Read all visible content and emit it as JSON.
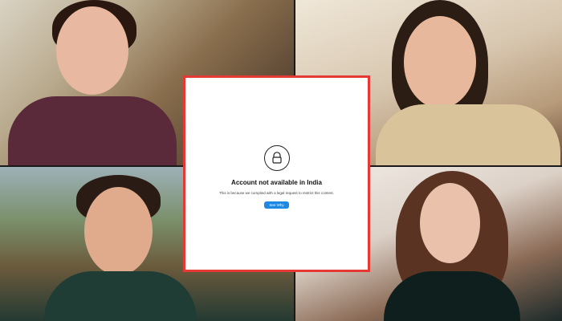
{
  "collage": {
    "tiles": [
      {
        "name": "photo-top-left",
        "accent": "#8a3a5a"
      },
      {
        "name": "photo-top-right",
        "accent": "#c8a772"
      },
      {
        "name": "photo-bottom-left",
        "accent": "#214537"
      },
      {
        "name": "photo-bottom-right",
        "accent": "#10201f"
      }
    ]
  },
  "notice": {
    "icon": "lock-icon",
    "title": "Account not available in India",
    "message": "This is because we complied with a legal request to restrict this content.",
    "button_label": "See Why",
    "border_color": "#e53935",
    "button_color": "#1e88e5"
  }
}
